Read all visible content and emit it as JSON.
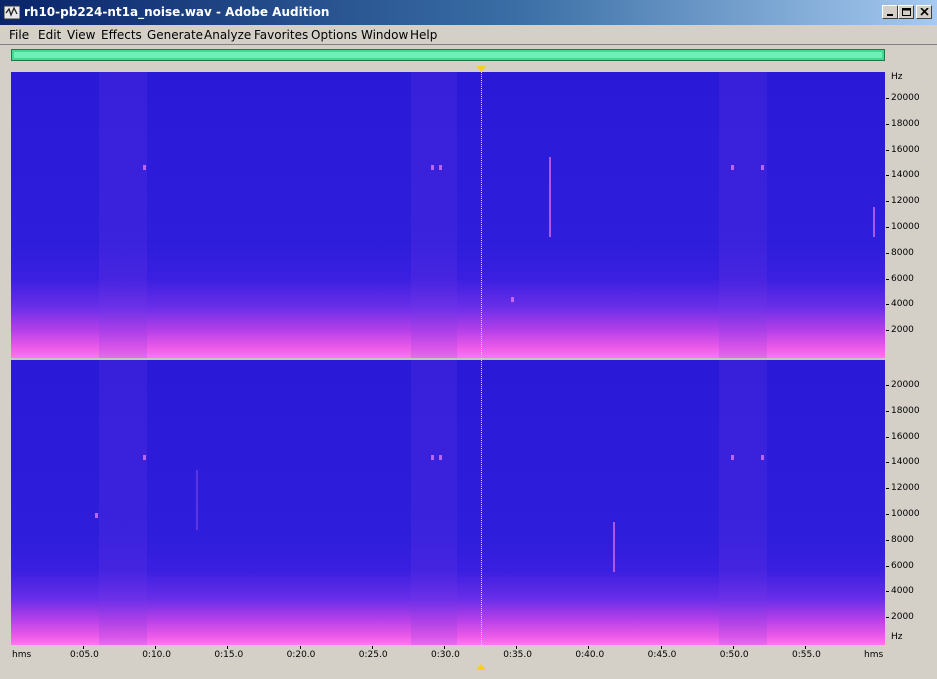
{
  "window": {
    "title": "rh10-pb224-nt1a_noise.wav - Adobe Audition"
  },
  "menu": [
    {
      "label": "File",
      "acc": "F",
      "rest": "ile"
    },
    {
      "label": "Edit",
      "acc": "E",
      "rest": "dit"
    },
    {
      "label": "View",
      "acc": "V",
      "rest": "iew"
    },
    {
      "label": "Effects",
      "acc": "",
      "pre": "Effe",
      "acc2": "c",
      "rest": "ts"
    },
    {
      "label": "Generate",
      "acc": "G",
      "rest": "enerate"
    },
    {
      "label": "Analyze",
      "acc": "A",
      "rest": "nalyze"
    },
    {
      "label": "Favorites",
      "acc": "",
      "pre": "Fav",
      "acc2": "o",
      "rest": "rites"
    },
    {
      "label": "Options",
      "acc": "O",
      "rest": "ptions"
    },
    {
      "label": "Window",
      "acc": "W",
      "rest": "indow"
    },
    {
      "label": "Help",
      "acc": "H",
      "rest": "elp"
    }
  ],
  "freq_ruler_top": {
    "unit": "Hz",
    "labels": [
      "20000",
      "18000",
      "16000",
      "14000",
      "12000",
      "10000",
      "8000",
      "6000",
      "4000",
      "2000"
    ]
  },
  "freq_ruler_bottom": {
    "unit": "Hz",
    "labels": [
      "20000",
      "18000",
      "16000",
      "14000",
      "12000",
      "10000",
      "8000",
      "6000",
      "4000",
      "2000"
    ]
  },
  "time_ruler": {
    "start_label": "hms",
    "end_label": "hms",
    "labels": [
      "0:05.0",
      "0:10.0",
      "0:15.0",
      "0:20.0",
      "0:25.0",
      "0:30.0",
      "0:35.0",
      "0:40.0",
      "0:45.0",
      "0:50.0",
      "0:55.0"
    ]
  },
  "colors": {
    "title_gradient_start": "#0a246a",
    "spectral_low": "#2a1ad8",
    "spectral_high": "#ff78f0",
    "overview_bar": "#44d895",
    "cursor": "#f5d020"
  },
  "icons": {
    "app": "audition-icon",
    "minimize": "minimize-icon",
    "maximize": "maximize-icon",
    "close": "close-icon"
  }
}
